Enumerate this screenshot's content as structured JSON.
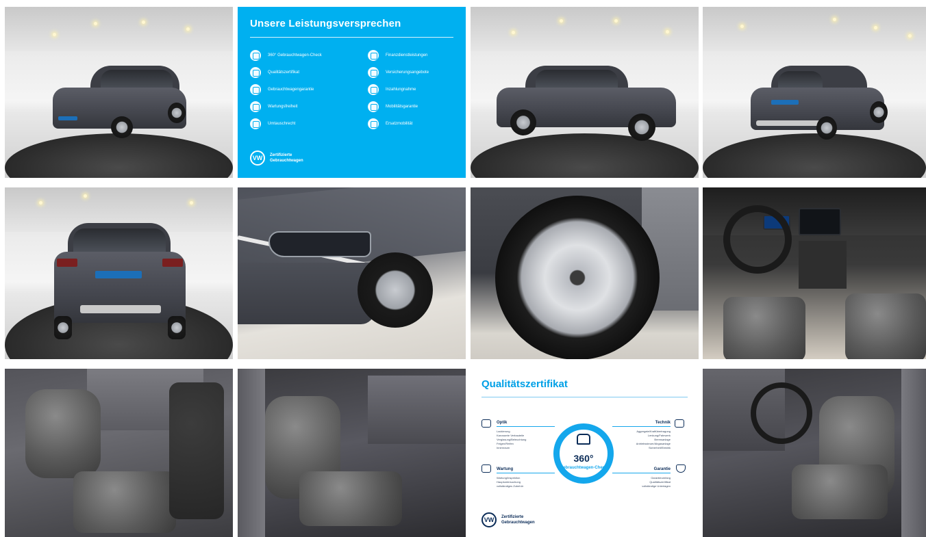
{
  "gallery": {
    "tiles": [
      {
        "kind": "photo",
        "subject": "car-front-left"
      },
      {
        "kind": "promo"
      },
      {
        "kind": "photo",
        "subject": "car-side-right"
      },
      {
        "kind": "photo",
        "subject": "car-rear-right"
      },
      {
        "kind": "photo",
        "subject": "car-rear"
      },
      {
        "kind": "photo",
        "subject": "car-headlight-detail"
      },
      {
        "kind": "photo",
        "subject": "alloy-wheel"
      },
      {
        "kind": "photo",
        "subject": "dashboard-interior"
      },
      {
        "kind": "photo",
        "subject": "rear-seats"
      },
      {
        "kind": "photo",
        "subject": "front-passenger-seat"
      },
      {
        "kind": "certificate"
      },
      {
        "kind": "photo",
        "subject": "driver-seat"
      }
    ]
  },
  "promo": {
    "title": "Unsere Leistungsversprechen",
    "left_items": [
      "360° Gebrauchtwagen-Check",
      "Qualitätszertifikat",
      "Gebrauchtwagengarantie",
      "Wartungsfreiheit",
      "Umtauschrecht"
    ],
    "right_items": [
      "Finanzdienstleistungen",
      "Versicherungsangebote",
      "Inzahlungnahme",
      "Mobilitätsgarantie",
      "Ersatzmobilität"
    ],
    "brand_line1": "Zertifizierte",
    "brand_line2": "Gebrauchtwagen",
    "logo": "VW"
  },
  "certificate": {
    "title": "Qualitätszertifikat",
    "badge_number": "360°",
    "badge_arc": "Gebrauchtwagen-Check",
    "sections": {
      "optik": {
        "head": "Optik",
        "items": [
          "Lackierung",
          "Karosserie Verbauteile",
          "Verglasung/Beleuchtung",
          "Felgen/Reifen",
          "Innenraum"
        ]
      },
      "technik": {
        "head": "Technik",
        "items": [
          "Aggregate/Kraftübertragung",
          "Lenkung/Fahrwerk",
          "Bremsanlage",
          "Antriebssteuer/Abgasanlage",
          "Sicherheit/Elektrik"
        ]
      },
      "wartung": {
        "head": "Wartung",
        "items": [
          "Wartung/Inspektion",
          "Hauptuntersuchung",
          "vollständiges Zubehör"
        ]
      },
      "garantie": {
        "head": "Garantie",
        "items": [
          "Garantieumfang",
          "Qualitätszertifikat",
          "vollständige Unterlagen"
        ]
      }
    },
    "brand_line1": "Zertifizierte",
    "brand_line2": "Gebrauchtwagen",
    "logo": "VW"
  },
  "colors": {
    "vw_blue": "#00b0f0",
    "navy": "#0a2b57",
    "car_grey": "#4a4c54"
  }
}
